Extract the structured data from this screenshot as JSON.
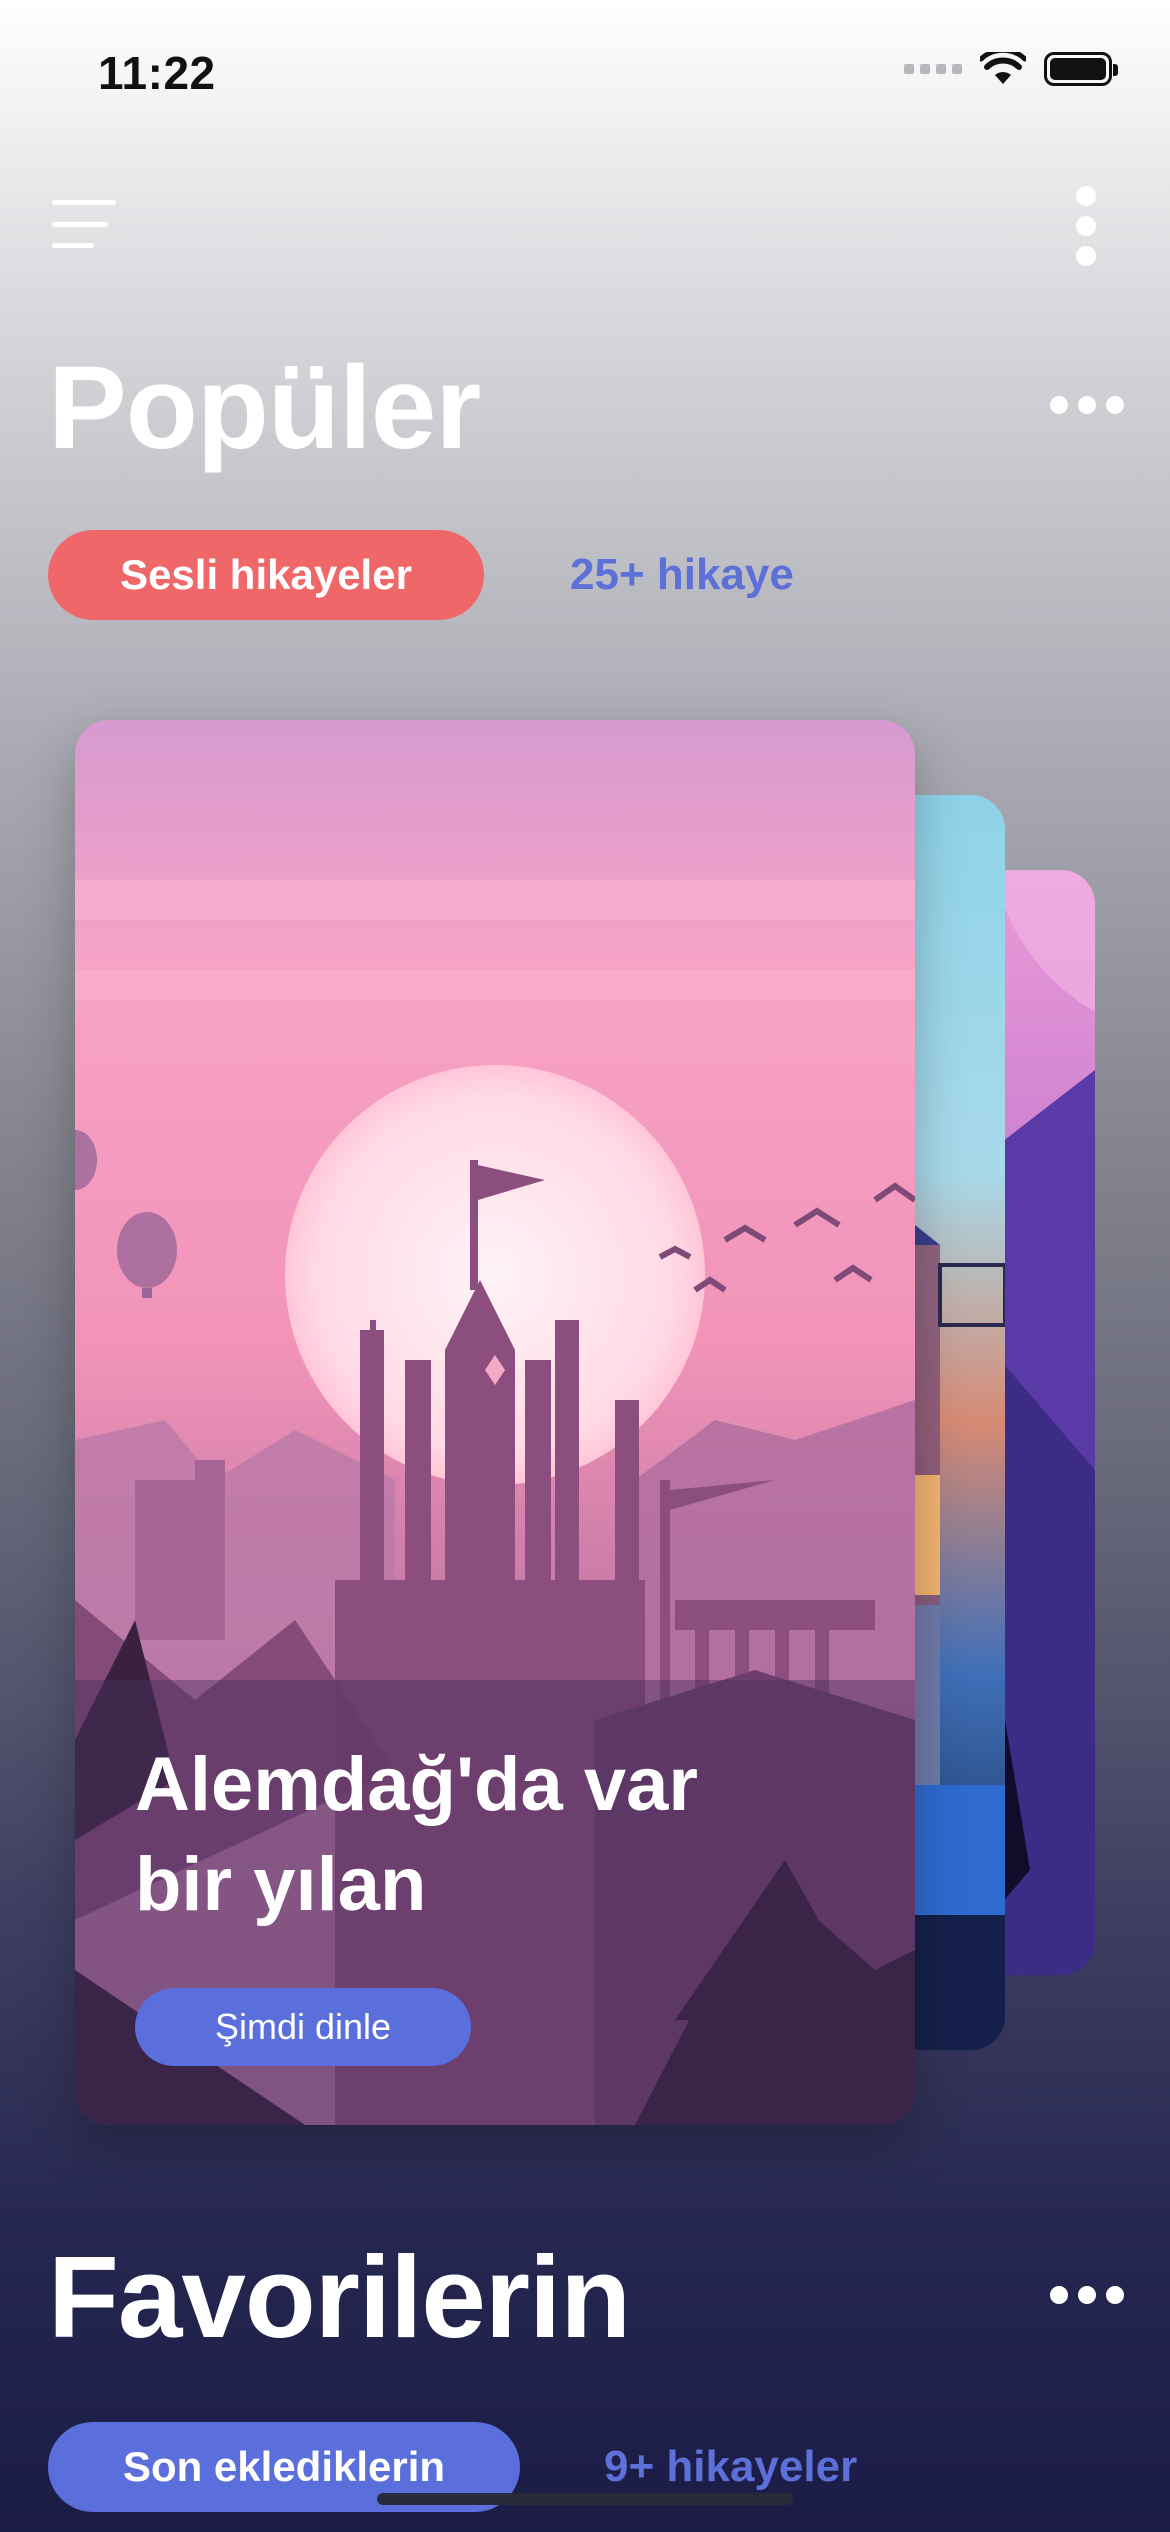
{
  "status_bar": {
    "time": "11:22"
  },
  "popular": {
    "title": "Popüler",
    "category_label": "Sesli hikayeler",
    "count_label": "25+ hikaye"
  },
  "featured_card": {
    "title_line1": "Alemdağ'da var",
    "title_line2": "bir yılan",
    "button_label": "Şimdi dinle"
  },
  "favorites": {
    "title": "Favorilerin",
    "category_label": "Son eklediklerin",
    "count_label": "9+ hikayeler"
  },
  "colors": {
    "pill_red": "#f0676a",
    "pill_blue": "#5a6fdc",
    "count_blue": "#5c70d8"
  }
}
